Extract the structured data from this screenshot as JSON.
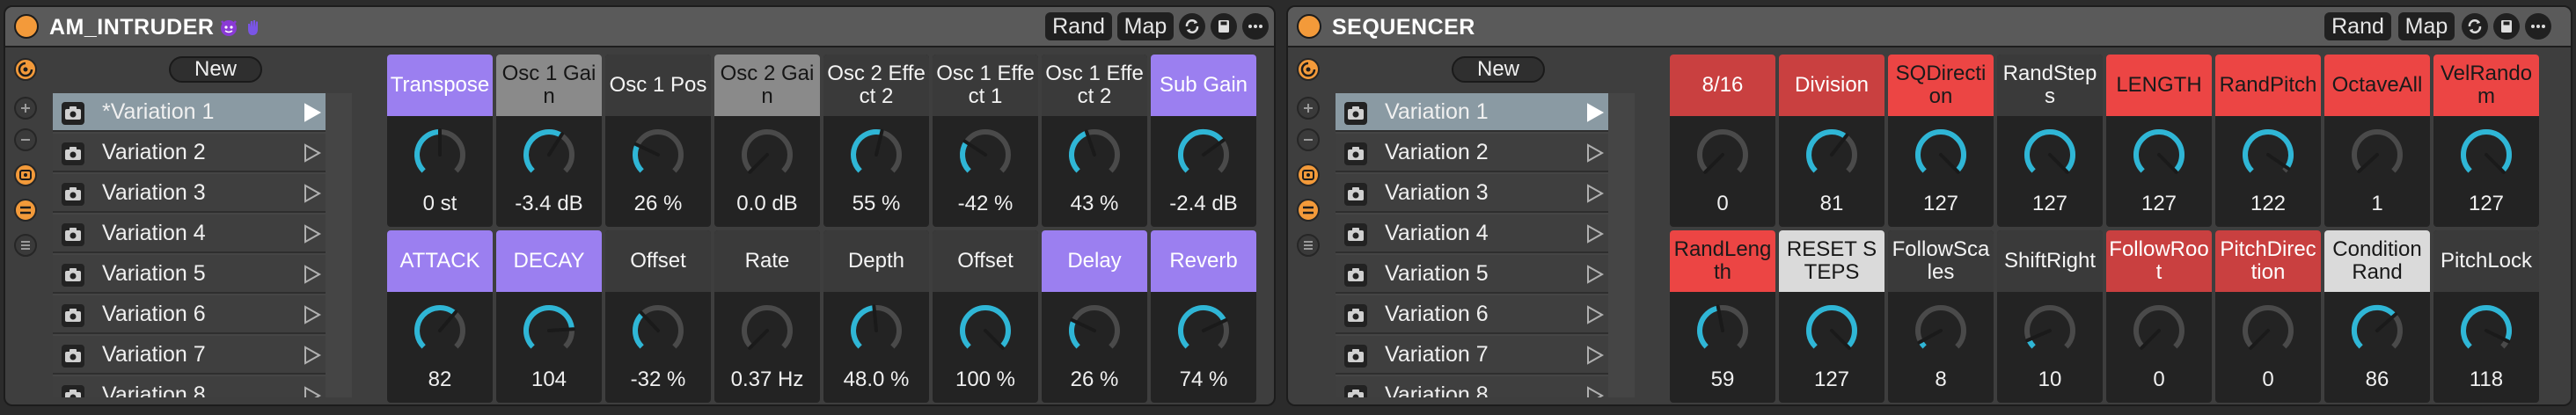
{
  "racks": [
    {
      "title": "AM_INTRUDER",
      "emoji": [
        "devil-face-icon",
        "hand-icon"
      ],
      "buttons": {
        "rand": "Rand",
        "map": "Map"
      },
      "new_label": "New",
      "variations": [
        "*Variation 1",
        "Variation 2",
        "Variation 3",
        "Variation 4",
        "Variation 5",
        "Variation 6",
        "Variation 7",
        "Variation 8"
      ],
      "selected_variation": 0,
      "macros": [
        {
          "label": "Transpose",
          "value": "0 st",
          "level": 0.5,
          "style": "purple"
        },
        {
          "label": "Osc 1 Gain",
          "value": "-3.4 dB",
          "level": 0.62,
          "style": "gray"
        },
        {
          "label": "Osc 1 Pos",
          "value": "26 %",
          "level": 0.26,
          "style": "dkgray"
        },
        {
          "label": "Osc 2 Gain",
          "value": "0.0 dB",
          "level": 0.0,
          "style": "gray"
        },
        {
          "label": "Osc 2 Effect 2",
          "value": "55 %",
          "level": 0.55,
          "style": "dkgray"
        },
        {
          "label": "Osc 1 Effect 1",
          "value": "-42 %",
          "level": 0.29,
          "style": "dkgray"
        },
        {
          "label": "Osc 1 Effect 2",
          "value": "43 %",
          "level": 0.43,
          "style": "dkgray"
        },
        {
          "label": "Sub Gain",
          "value": "-2.4 dB",
          "level": 0.7,
          "style": "purple"
        },
        {
          "label": "ATTACK",
          "value": "82",
          "level": 0.65,
          "style": "purple"
        },
        {
          "label": "DECAY",
          "value": "104",
          "level": 0.82,
          "style": "purple"
        },
        {
          "label": "Offset",
          "value": "-32 %",
          "level": 0.34,
          "style": "dkgray"
        },
        {
          "label": "Rate",
          "value": "0.37 Hz",
          "level": 0.0,
          "style": "dkgray"
        },
        {
          "label": "Depth",
          "value": "48.0 %",
          "level": 0.48,
          "style": "dkgray"
        },
        {
          "label": "Offset",
          "value": "100 %",
          "level": 1.0,
          "style": "dkgray"
        },
        {
          "label": "Delay",
          "value": "26 %",
          "level": 0.26,
          "style": "purple"
        },
        {
          "label": "Reverb",
          "value": "74 %",
          "level": 0.74,
          "style": "purple"
        }
      ]
    },
    {
      "title": "SEQUENCER",
      "emoji": [],
      "buttons": {
        "rand": "Rand",
        "map": "Map"
      },
      "new_label": "New",
      "variations": [
        "Variation 1",
        "Variation 2",
        "Variation 3",
        "Variation 4",
        "Variation 5",
        "Variation 6",
        "Variation 7",
        "Variation 8"
      ],
      "selected_variation": 0,
      "macros": [
        {
          "label": "8/16",
          "value": "0",
          "level": 0.0,
          "style": "dkred"
        },
        {
          "label": "Division",
          "value": "81",
          "level": 0.64,
          "style": "dkred"
        },
        {
          "label": "SQDirection",
          "value": "127",
          "level": 1.0,
          "style": "red"
        },
        {
          "label": "RandSteps",
          "value": "127",
          "level": 1.0,
          "style": "dkgray"
        },
        {
          "label": "LENGTH",
          "value": "127",
          "level": 1.0,
          "style": "red"
        },
        {
          "label": "RandPitch",
          "value": "122",
          "level": 0.96,
          "style": "red"
        },
        {
          "label": "OctaveAll",
          "value": "1",
          "level": 0.01,
          "style": "red"
        },
        {
          "label": "VelRandom",
          "value": "127",
          "level": 1.0,
          "style": "red"
        },
        {
          "label": "RandLength",
          "value": "59",
          "level": 0.46,
          "style": "red"
        },
        {
          "label": "RESET STEPS",
          "value": "127",
          "level": 1.0,
          "style": "white"
        },
        {
          "label": "FollowScales",
          "value": "8",
          "level": 0.06,
          "style": "dkgray"
        },
        {
          "label": "ShiftRight",
          "value": "10",
          "level": 0.08,
          "style": "dkgray"
        },
        {
          "label": "FollowRoot",
          "value": "0",
          "level": 0.0,
          "style": "dkred"
        },
        {
          "label": "PitchDirection",
          "value": "0",
          "level": 0.0,
          "style": "dkred"
        },
        {
          "label": "ConditionRand",
          "value": "86",
          "level": 0.68,
          "style": "white"
        },
        {
          "label": "PitchLock",
          "value": "118",
          "level": 0.93,
          "style": "dkgray"
        }
      ]
    }
  ],
  "colors": {
    "accent": "#f39a3a",
    "knob_ring": "#2fb6d6",
    "knob_track": "#4a4a4a",
    "purple": "#9b7ff0",
    "red": "#ec4544"
  },
  "icons": [
    "power-icon",
    "hot-swap-icon",
    "add-icon",
    "remove-icon",
    "macro-icon",
    "randomize-icon",
    "list-icon",
    "refresh-icon",
    "save-icon",
    "more-icon",
    "camera-icon",
    "play-icon"
  ]
}
